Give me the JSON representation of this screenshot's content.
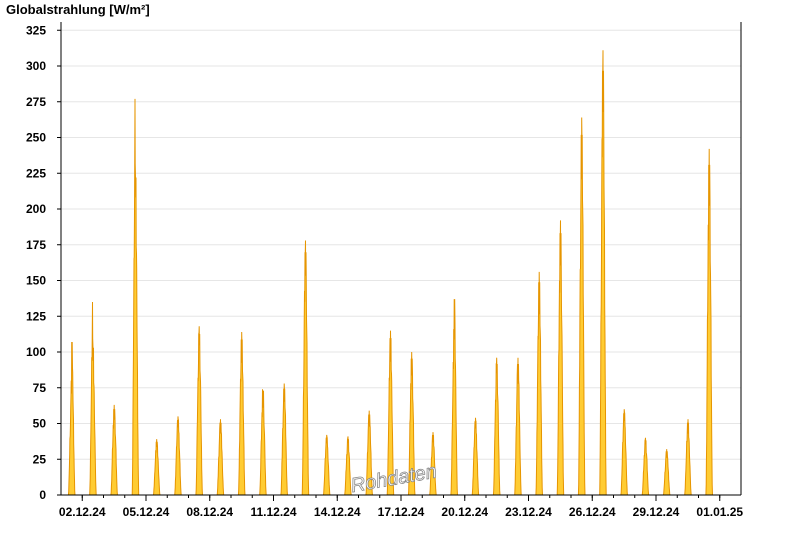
{
  "chart_data": {
    "type": "area",
    "title": "Globalstrahlung [W/m²]",
    "xlabel": "",
    "ylabel": "",
    "ylim": [
      0,
      330
    ],
    "yticks": [
      0,
      25,
      50,
      75,
      100,
      125,
      150,
      175,
      200,
      225,
      250,
      275,
      300,
      325
    ],
    "x_range": [
      "2024-12-01",
      "2025-01-02"
    ],
    "xtick_labels": [
      "02.12.24",
      "05.12.24",
      "08.12.24",
      "11.12.24",
      "14.12.24",
      "17.12.24",
      "20.12.24",
      "23.12.24",
      "26.12.24",
      "29.12.24",
      "01.01.25"
    ],
    "grid": "horizontal",
    "colors": {
      "fill": "#ffcc33",
      "outline": "#e69500"
    },
    "watermark": "Rohdaten",
    "series": [
      {
        "values": [
          {
            "date": "2024-12-01",
            "peaks": [
              80,
              107
            ]
          },
          {
            "date": "2024-12-02",
            "peaks": [
              135,
              103
            ]
          },
          {
            "date": "2024-12-03",
            "peaks": [
              63
            ]
          },
          {
            "date": "2024-12-04",
            "peaks": [
              277,
              222
            ]
          },
          {
            "date": "2024-12-05",
            "peaks": [
              39
            ]
          },
          {
            "date": "2024-12-06",
            "peaks": [
              55
            ]
          },
          {
            "date": "2024-12-07",
            "peaks": [
              118
            ]
          },
          {
            "date": "2024-12-08",
            "peaks": [
              53
            ]
          },
          {
            "date": "2024-12-09",
            "peaks": [
              114
            ]
          },
          {
            "date": "2024-12-10",
            "peaks": [
              74,
              73
            ]
          },
          {
            "date": "2024-12-11",
            "peaks": [
              78
            ]
          },
          {
            "date": "2024-12-12",
            "peaks": [
              178
            ]
          },
          {
            "date": "2024-12-13",
            "peaks": [
              42
            ]
          },
          {
            "date": "2024-12-14",
            "peaks": [
              41
            ]
          },
          {
            "date": "2024-12-15",
            "peaks": [
              59
            ]
          },
          {
            "date": "2024-12-16",
            "peaks": [
              115
            ]
          },
          {
            "date": "2024-12-17",
            "peaks": [
              100
            ]
          },
          {
            "date": "2024-12-18",
            "peaks": [
              44
            ]
          },
          {
            "date": "2024-12-19",
            "peaks": [
              116,
              137
            ]
          },
          {
            "date": "2024-12-20",
            "peaks": [
              54
            ]
          },
          {
            "date": "2024-12-21",
            "peaks": [
              96
            ]
          },
          {
            "date": "2024-12-22",
            "peaks": [
              96
            ]
          },
          {
            "date": "2024-12-23",
            "peaks": [
              156
            ]
          },
          {
            "date": "2024-12-24",
            "peaks": [
              192
            ]
          },
          {
            "date": "2024-12-25",
            "peaks": [
              264
            ]
          },
          {
            "date": "2024-12-26",
            "peaks": [
              311
            ]
          },
          {
            "date": "2024-12-27",
            "peaks": [
              60
            ]
          },
          {
            "date": "2024-12-28",
            "peaks": [
              40
            ]
          },
          {
            "date": "2024-12-29",
            "peaks": [
              32
            ]
          },
          {
            "date": "2024-12-30",
            "peaks": [
              53
            ]
          },
          {
            "date": "2024-12-31",
            "peaks": [
              242
            ]
          }
        ]
      }
    ]
  }
}
